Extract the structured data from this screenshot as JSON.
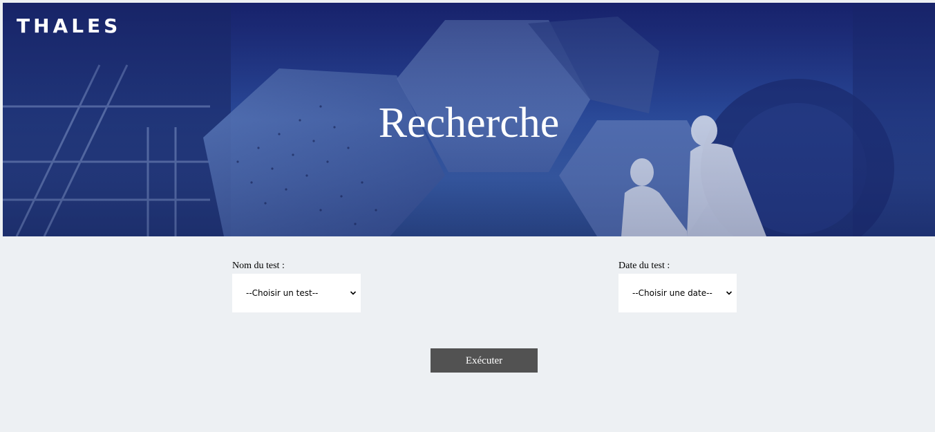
{
  "header": {
    "logo_text": "THALES",
    "title": "Recherche",
    "background_image": "cleanroom-hexagonal-mirrors"
  },
  "form": {
    "test_name": {
      "label": "Nom du test :",
      "selected": "--Choisir un test--"
    },
    "test_date": {
      "label": "Date du test :",
      "selected": "--Choisir une date--"
    },
    "execute_label": "Exécuter"
  },
  "colors": {
    "page_background": "#edf0f3",
    "banner_blue": "#2a4a9a",
    "button_background": "#525252",
    "button_text": "#ffffff"
  }
}
